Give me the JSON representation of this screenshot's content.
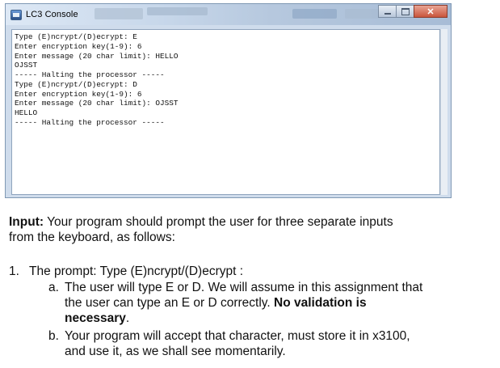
{
  "window": {
    "title": "LC3 Console",
    "controls": {
      "minimize": "minimize",
      "maximize": "maximize",
      "close": "close"
    }
  },
  "console": {
    "lines": [
      "Type (E)ncrypt/(D)ecrypt: E",
      "Enter encryption key(1-9): 6",
      "Enter message (20 char limit): HELLO",
      "OJSST",
      "----- Halting the processor -----",
      "Type (E)ncrypt/(D)ecrypt: D",
      "Enter encryption key(1-9): 6",
      "Enter message (20 char limit): OJSST",
      "HELLO",
      "----- Halting the processor -----"
    ]
  },
  "document": {
    "input_heading": "Input:",
    "input_text_1": " Your program should prompt the user for three separate inputs",
    "input_text_2": "from the keyboard, as follows:",
    "item1_number": "1.",
    "item1_text": "The prompt: Type (E)ncrypt/(D)ecrypt :",
    "item_a_letter": "a.",
    "item_a_text_1": "The user will type E or D. We will assume in this assignment that",
    "item_a_text_2_prefix": "the user can type an E or D correctly. ",
    "item_a_text_2_bold": "No validation is",
    "item_a_text_3_bold": "necessary",
    "item_a_text_3_suffix": ".",
    "item_b_letter": "b.",
    "item_b_text_1": "Your program will accept that character, must store it in x3100,",
    "item_b_text_2": "and use it, as we shall see momentarily."
  }
}
